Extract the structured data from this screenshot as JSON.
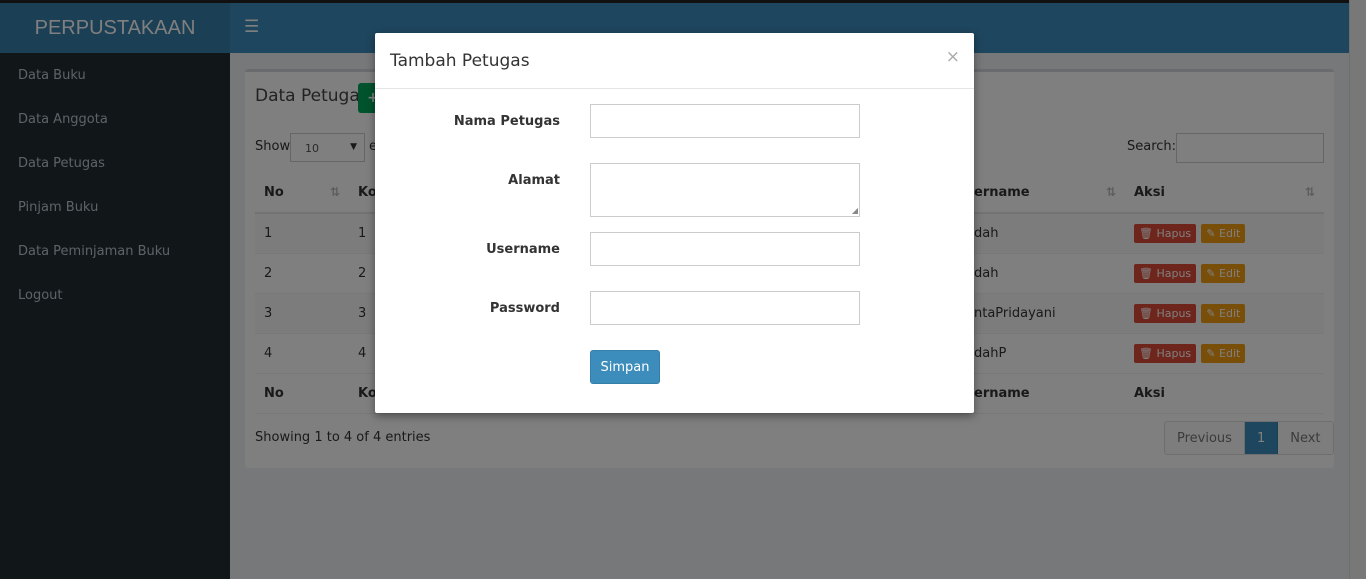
{
  "header": {
    "brand": "PERPUSTAKAAN",
    "menu_toggle_icon": "hamburger-icon"
  },
  "sidebar": {
    "items": [
      {
        "label": "Data Buku"
      },
      {
        "label": "Data Anggota"
      },
      {
        "label": "Data Petugas"
      },
      {
        "label": "Pinjam Buku"
      },
      {
        "label": "Data Peminjaman Buku"
      },
      {
        "label": "Logout"
      }
    ]
  },
  "main": {
    "title": "Data Petugas",
    "add_label": "+",
    "show_label": "Show",
    "page_length": "10",
    "entries_fragment": "e",
    "search_label": "Search:",
    "search_value": "",
    "columns": {
      "no": "No",
      "kode_frag": "Ko",
      "username_frag": "ername",
      "aksi": "Aksi"
    },
    "rows": [
      {
        "no": "1",
        "kode": "1",
        "username": "dah"
      },
      {
        "no": "2",
        "kode": "2",
        "username": "dah"
      },
      {
        "no": "3",
        "kode": "3",
        "username": "ntaPridayani"
      },
      {
        "no": "4",
        "kode": "4",
        "username": "dahP"
      }
    ],
    "action_delete": "Hapus",
    "action_edit": "Edit",
    "info": "Showing 1 to 4 of 4 entries",
    "pagination": {
      "previous": "Previous",
      "current": "1",
      "next": "Next"
    }
  },
  "modal": {
    "title": "Tambah Petugas",
    "close": "×",
    "fields": {
      "nama": {
        "label": "Nama Petugas",
        "value": ""
      },
      "alamat": {
        "label": "Alamat",
        "value": ""
      },
      "username": {
        "label": "Username",
        "value": ""
      },
      "password": {
        "label": "Password",
        "value": ""
      }
    },
    "submit": "Simpan"
  },
  "colors": {
    "navbar": "#3c8dbc",
    "brand": "#367fa9",
    "sidebar": "#222d32",
    "danger": "#dd4b39",
    "warning": "#f39c12",
    "success": "#00a65a"
  }
}
